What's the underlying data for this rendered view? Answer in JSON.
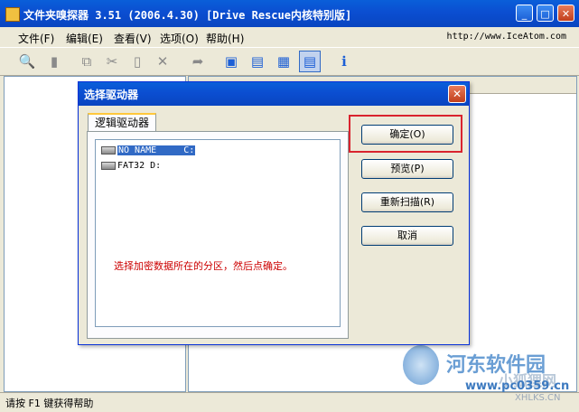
{
  "window": {
    "title": "文件夹嗅探器 3.51 (2006.4.30) [Drive Rescue内核特别版]",
    "controls": {
      "minimize": "_",
      "maximize": "□",
      "close": "✕"
    }
  },
  "menubar": {
    "items": [
      {
        "label": "文件(F)"
      },
      {
        "label": "编辑(E)"
      },
      {
        "label": "查看(V)"
      },
      {
        "label": "选项(O)"
      },
      {
        "label": "帮助(H)"
      }
    ],
    "url": "http://www.IceAtom.com"
  },
  "toolbar": {
    "icons": [
      "search-icon",
      "document-icon",
      "copy-icon",
      "cut-icon",
      "paste-icon",
      "delete-icon",
      "export-icon",
      "view-large-icon",
      "view-small-icon",
      "view-list-icon",
      "view-detail-icon",
      "info-icon"
    ]
  },
  "dialog": {
    "title": "选择驱动器",
    "close": "✕",
    "tab": "逻辑驱动器",
    "drives": [
      {
        "name": "NO NAME",
        "letter": "C:",
        "selected": true
      },
      {
        "name": "FAT32",
        "letter": "D:",
        "selected": false
      }
    ],
    "hint": "选择加密数据所在的分区，然后点确定。",
    "buttons": {
      "ok": "确定(O)",
      "preview": "预览(P)",
      "rescan": "重新扫描(R)",
      "cancel": "取消"
    }
  },
  "statusbar": {
    "text": "请按 F1 键获得帮助"
  },
  "watermark": {
    "title": "河东软件园",
    "url": "www.pc0359.cn",
    "site": "XHLKS.CN",
    "mark": "小狐狸网"
  }
}
